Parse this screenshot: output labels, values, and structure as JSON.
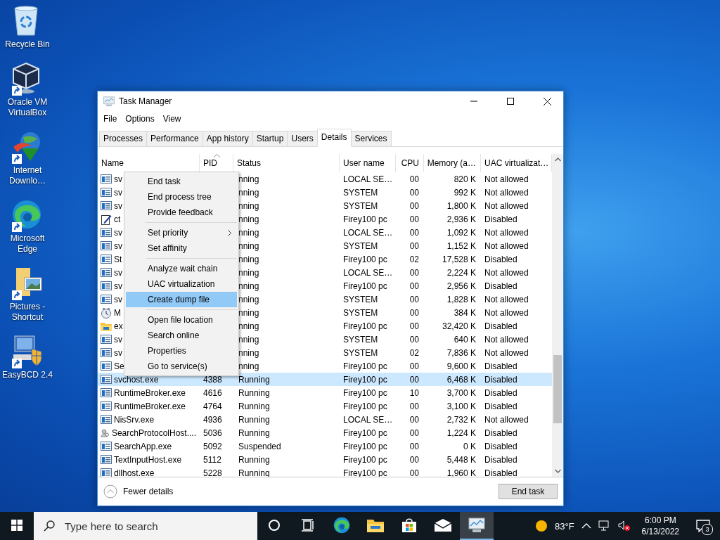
{
  "desktop_icons": [
    {
      "kind": "recycle",
      "label": "Recycle Bin",
      "shortcut": false
    },
    {
      "kind": "virtualbox",
      "label": "Oracle VM VirtualBox",
      "shortcut": true
    },
    {
      "kind": "downloader",
      "label": "Internet Downlo…",
      "shortcut": true
    },
    {
      "kind": "edge",
      "label": "Microsoft Edge",
      "shortcut": true
    },
    {
      "kind": "pictures",
      "label": "Pictures - Shortcut",
      "shortcut": true
    },
    {
      "kind": "easybcd",
      "label": "EasyBCD 2.4",
      "shortcut": true
    }
  ],
  "window": {
    "title": "Task Manager",
    "menu": [
      "File",
      "Options",
      "View"
    ],
    "tabs": [
      {
        "label": "Processes",
        "selected": false
      },
      {
        "label": "Performance",
        "selected": false
      },
      {
        "label": "App history",
        "selected": false
      },
      {
        "label": "Startup",
        "selected": false
      },
      {
        "label": "Users",
        "selected": false
      },
      {
        "label": "Details",
        "selected": true
      },
      {
        "label": "Services",
        "selected": false
      }
    ],
    "table": {
      "columns": [
        {
          "label": "Name",
          "sorted": false
        },
        {
          "label": "PID",
          "sorted": true
        },
        {
          "label": "Status",
          "sorted": false
        },
        {
          "label": "User name",
          "sorted": false
        },
        {
          "label": "CPU",
          "sorted": false
        },
        {
          "label": "Memory (a…",
          "sorted": false
        },
        {
          "label": "UAC virtualizat…",
          "sorted": false
        }
      ],
      "rows": [
        {
          "kind": "app",
          "name": "sv",
          "status": "nning",
          "user": "LOCAL SE…",
          "cpu": "00",
          "memory": "820 K",
          "uac": "Not allowed",
          "selected": false
        },
        {
          "kind": "app",
          "name": "sv",
          "status": "nning",
          "user": "SYSTEM",
          "cpu": "00",
          "memory": "992 K",
          "uac": "Not allowed",
          "selected": false
        },
        {
          "kind": "app",
          "name": "sv",
          "status": "nning",
          "user": "SYSTEM",
          "cpu": "00",
          "memory": "1,800 K",
          "uac": "Not allowed",
          "selected": false
        },
        {
          "kind": "edit",
          "name": "ct",
          "status": "nning",
          "user": "Firey100 pc",
          "cpu": "00",
          "memory": "2,936 K",
          "uac": "Disabled",
          "selected": false
        },
        {
          "kind": "app",
          "name": "sv",
          "status": "nning",
          "user": "LOCAL SE…",
          "cpu": "00",
          "memory": "1,092 K",
          "uac": "Not allowed",
          "selected": false
        },
        {
          "kind": "app",
          "name": "sv",
          "status": "nning",
          "user": "SYSTEM",
          "cpu": "00",
          "memory": "1,152 K",
          "uac": "Not allowed",
          "selected": false
        },
        {
          "kind": "app",
          "name": "St",
          "status": "nning",
          "user": "Firey100 pc",
          "cpu": "02",
          "memory": "17,528 K",
          "uac": "Disabled",
          "selected": false
        },
        {
          "kind": "app",
          "name": "sv",
          "status": "nning",
          "user": "LOCAL SE…",
          "cpu": "00",
          "memory": "2,224 K",
          "uac": "Not allowed",
          "selected": false
        },
        {
          "kind": "app",
          "name": "sv",
          "status": "nning",
          "user": "Firey100 pc",
          "cpu": "00",
          "memory": "2,956 K",
          "uac": "Disabled",
          "selected": false
        },
        {
          "kind": "app",
          "name": "sv",
          "status": "nning",
          "user": "SYSTEM",
          "cpu": "00",
          "memory": "1,828 K",
          "uac": "Not allowed",
          "selected": false
        },
        {
          "kind": "clock",
          "name": "M",
          "status": "nning",
          "user": "SYSTEM",
          "cpu": "00",
          "memory": "384 K",
          "uac": "Not allowed",
          "selected": false
        },
        {
          "kind": "folder",
          "name": "ex",
          "status": "nning",
          "user": "Firey100 pc",
          "cpu": "00",
          "memory": "32,420 K",
          "uac": "Disabled",
          "selected": false
        },
        {
          "kind": "app",
          "name": "sv",
          "status": "nning",
          "user": "SYSTEM",
          "cpu": "00",
          "memory": "640 K",
          "uac": "Not allowed",
          "selected": false
        },
        {
          "kind": "app",
          "name": "sv",
          "status": "nning",
          "user": "SYSTEM",
          "cpu": "02",
          "memory": "7,836 K",
          "uac": "Not allowed",
          "selected": false
        },
        {
          "kind": "app",
          "name": "Se",
          "status": "nning",
          "user": "Firey100 pc",
          "cpu": "00",
          "memory": "9,600 K",
          "uac": "Disabled",
          "selected": false
        },
        {
          "kind": "app",
          "name": "svchost.exe",
          "pid": "4388",
          "status": "Running",
          "user": "Firey100 pc",
          "cpu": "00",
          "memory": "6,468 K",
          "uac": "Disabled",
          "selected": true
        },
        {
          "kind": "app",
          "name": "RuntimeBroker.exe",
          "pid": "4616",
          "status": "Running",
          "user": "Firey100 pc",
          "cpu": "10",
          "memory": "3,700 K",
          "uac": "Disabled",
          "selected": false
        },
        {
          "kind": "app",
          "name": "RuntimeBroker.exe",
          "pid": "4764",
          "status": "Running",
          "user": "Firey100 pc",
          "cpu": "00",
          "memory": "3,100 K",
          "uac": "Disabled",
          "selected": false
        },
        {
          "kind": "app",
          "name": "NisSrv.exe",
          "pid": "4936",
          "status": "Running",
          "user": "LOCAL SE…",
          "cpu": "00",
          "memory": "2,732 K",
          "uac": "Not allowed",
          "selected": false
        },
        {
          "kind": "search",
          "name": "SearchProtocolHost....",
          "pid": "5036",
          "status": "Running",
          "user": "Firey100 pc",
          "cpu": "00",
          "memory": "1,224 K",
          "uac": "Disabled",
          "selected": false
        },
        {
          "kind": "app",
          "name": "SearchApp.exe",
          "pid": "5092",
          "status": "Suspended",
          "user": "Firey100 pc",
          "cpu": "00",
          "memory": "0 K",
          "uac": "Disabled",
          "selected": false
        },
        {
          "kind": "app",
          "name": "TextInputHost.exe",
          "pid": "5112",
          "status": "Running",
          "user": "Firey100 pc",
          "cpu": "00",
          "memory": "5,448 K",
          "uac": "Disabled",
          "selected": false
        },
        {
          "kind": "app",
          "name": "dllhost.exe",
          "pid": "5228",
          "status": "Running",
          "user": "Firey100 pc",
          "cpu": "00",
          "memory": "1,960 K",
          "uac": "Disabled",
          "selected": false
        }
      ]
    },
    "context_menu": [
      {
        "kind": "item",
        "label": "End task",
        "selected": false
      },
      {
        "kind": "item",
        "label": "End process tree",
        "selected": false
      },
      {
        "kind": "item",
        "label": "Provide feedback",
        "selected": false
      },
      {
        "kind": "separator"
      },
      {
        "kind": "submenu",
        "label": "Set priority",
        "selected": false
      },
      {
        "kind": "item",
        "label": "Set affinity",
        "selected": false
      },
      {
        "kind": "separator"
      },
      {
        "kind": "item",
        "label": "Analyze wait chain",
        "selected": false
      },
      {
        "kind": "item",
        "label": "UAC virtualization",
        "selected": false
      },
      {
        "kind": "item",
        "label": "Create dump file",
        "selected": true
      },
      {
        "kind": "separator"
      },
      {
        "kind": "item",
        "label": "Open file location",
        "selected": false
      },
      {
        "kind": "item",
        "label": "Search online",
        "selected": false
      },
      {
        "kind": "item",
        "label": "Properties",
        "selected": false
      },
      {
        "kind": "item",
        "label": "Go to service(s)",
        "selected": false
      }
    ],
    "footer": {
      "fewer_details": "Fewer details",
      "end_task": "End task"
    }
  },
  "taskbar": {
    "search_placeholder": "Type here to search",
    "apps": [
      {
        "kind": "cortana",
        "active": false
      },
      {
        "kind": "taskview",
        "active": false
      },
      {
        "kind": "edge",
        "active": false
      },
      {
        "kind": "explorer",
        "active": false
      },
      {
        "kind": "store",
        "active": false
      },
      {
        "kind": "mail",
        "active": false
      },
      {
        "kind": "taskmgr",
        "active": true
      }
    ],
    "weather": "83°F",
    "time": "6:00 PM",
    "date": "6/13/2022",
    "notifications": "3"
  }
}
